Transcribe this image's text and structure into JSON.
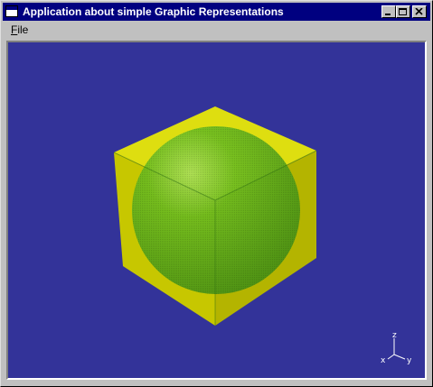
{
  "window": {
    "title": "Application about simple Graphic Representations"
  },
  "menu": {
    "file_label": "File",
    "file_mnemonic": "F",
    "file_rest": "ile"
  },
  "scene": {
    "background_color": "#333399",
    "cube_color": "#c8c800",
    "sphere_color": "#55aa22",
    "axis": {
      "z_label": "z",
      "x_label": "x",
      "y_label": "y"
    }
  },
  "icons": [
    "app-window-icon",
    "minimize-icon",
    "maximize-icon",
    "close-icon",
    "axis-triad-icon"
  ]
}
